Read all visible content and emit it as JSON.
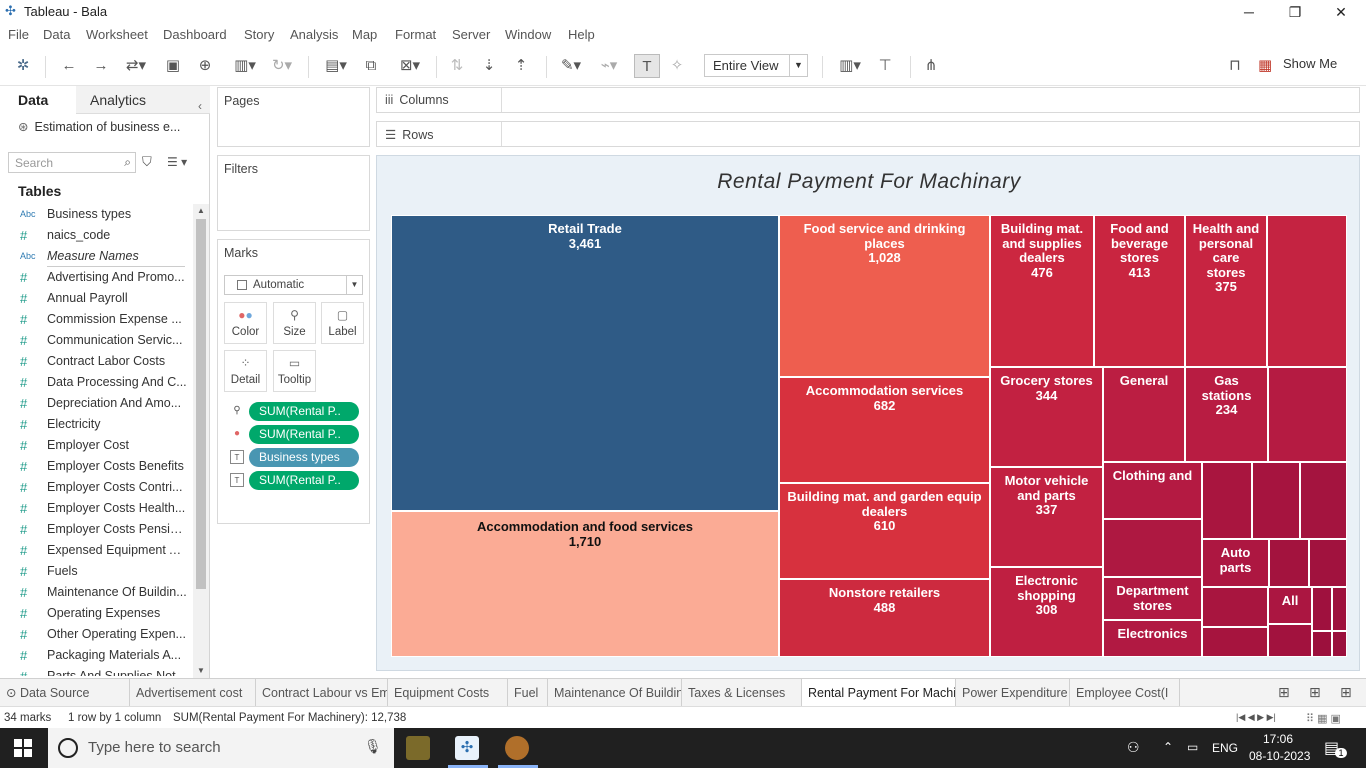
{
  "window": {
    "title": "Tableau - Bala",
    "min": "─",
    "max": "❐",
    "close": "✕"
  },
  "menu": [
    "File",
    "Data",
    "Worksheet",
    "Dashboard",
    "Story",
    "Analysis",
    "Map",
    "Format",
    "Server",
    "Window",
    "Help"
  ],
  "toolbar": {
    "view_select": "Entire View",
    "show_me": "Show Me"
  },
  "datapane": {
    "tab_data": "Data",
    "tab_analytics": "Analytics",
    "datasource": "Estimation of business e...",
    "search_placeholder": "Search",
    "tables_header": "Tables",
    "fields": [
      {
        "type": "Abc",
        "name": "Business types"
      },
      {
        "type": "#",
        "name": "naics_code"
      },
      {
        "type": "Abc",
        "name": "Measure Names"
      },
      {
        "type": "#",
        "name": "Advertising And Promo..."
      },
      {
        "type": "#",
        "name": "Annual Payroll"
      },
      {
        "type": "#",
        "name": "Commission Expense ..."
      },
      {
        "type": "#",
        "name": "Communication Servic..."
      },
      {
        "type": "#",
        "name": "Contract Labor Costs"
      },
      {
        "type": "#",
        "name": "Data Processing And C..."
      },
      {
        "type": "#",
        "name": "Depreciation And Amo..."
      },
      {
        "type": "#",
        "name": "Electricity"
      },
      {
        "type": "#",
        "name": "Employer Cost"
      },
      {
        "type": "#",
        "name": "Employer Costs Benefits"
      },
      {
        "type": "#",
        "name": "Employer Costs Contri..."
      },
      {
        "type": "#",
        "name": "Employer Costs Health..."
      },
      {
        "type": "#",
        "name": "Employer Costs Pensio..."
      },
      {
        "type": "#",
        "name": "Expensed Equipment A..."
      },
      {
        "type": "#",
        "name": "Fuels"
      },
      {
        "type": "#",
        "name": "Maintenance Of Buildin..."
      },
      {
        "type": "#",
        "name": "Operating Expenses"
      },
      {
        "type": "#",
        "name": "Other Operating Expen..."
      },
      {
        "type": "#",
        "name": "Packaging Materials A..."
      },
      {
        "type": "#",
        "name": "Parts And Supplies Not..."
      }
    ]
  },
  "shelves": {
    "pages": "Pages",
    "filters": "Filters",
    "columns": "Columns",
    "rows": "Rows",
    "marks": "Marks",
    "mark_type": "Automatic",
    "mark_buttons": [
      "Color",
      "Size",
      "Label",
      "Detail",
      "Tooltip"
    ],
    "pills": [
      {
        "kind": "size",
        "label": "SUM(Rental P..",
        "color": "#00a86b"
      },
      {
        "kind": "color",
        "label": "SUM(Rental P..",
        "color": "#00a86b"
      },
      {
        "kind": "label",
        "label": "Business types",
        "color": "#4996b2"
      },
      {
        "kind": "label",
        "label": "SUM(Rental P..",
        "color": "#00a86b"
      }
    ]
  },
  "chart_data": {
    "type": "treemap",
    "title": "Rental Payment For Machinary",
    "cells": [
      {
        "name": "Retail Trade",
        "value": "3,461",
        "color": "#2f5b86"
      },
      {
        "name": "Accommodation and food services",
        "value": "1,710",
        "color": "#fbab95"
      },
      {
        "name": "Food service and drinking places",
        "value": "1,028",
        "color": "#ee5e4f"
      },
      {
        "name": "Accommodation services",
        "value": "682",
        "color": "#d7313e"
      },
      {
        "name": "Building mat. and garden equip dealers",
        "value": "610",
        "color": "#d7313e"
      },
      {
        "name": "Nonstore retailers",
        "value": "488",
        "color": "#cd2a3f"
      },
      {
        "name": "Building mat. and supplies dealers",
        "value": "476",
        "color": "#cc2740"
      },
      {
        "name": "Food and beverage stores",
        "value": "413",
        "color": "#c92540"
      },
      {
        "name": "Health and personal care stores",
        "value": "375",
        "color": "#c72441"
      },
      {
        "name": "Grocery stores",
        "value": "344",
        "color": "#c22141"
      },
      {
        "name": "Motor vehicle and parts",
        "value": "337",
        "color": "#c22141"
      },
      {
        "name": "Electronic shopping",
        "value": "308",
        "color": "#bf1f41"
      },
      {
        "name": "General",
        "value": "",
        "color": "#bb1e42"
      },
      {
        "name": "Gas stations",
        "value": "234",
        "color": "#b81c42"
      },
      {
        "name": "Clothing and",
        "value": "",
        "color": "#b41a42"
      },
      {
        "name": "Department stores",
        "value": "",
        "color": "#b11942"
      },
      {
        "name": "Electronics",
        "value": "",
        "color": "#b11942"
      },
      {
        "name": "Auto parts",
        "value": "",
        "color": "#ad1741"
      },
      {
        "name": "All",
        "value": "",
        "color": "#ab1641"
      }
    ],
    "total_label": "SUM(Rental Payment For Machinery): 12,738"
  },
  "sheet_tabs": [
    "Data Source",
    "Advertisement cost",
    "Contract Labour vs Employee",
    "Equipment Costs",
    "Fuel",
    "Maintenance Of Buildings",
    "Taxes & Licenses",
    "Rental Payment For Machinary",
    "Power Expenditure",
    "Employee Cost(I"
  ],
  "active_sheet": "Rental Payment For Machinary",
  "status": {
    "marks": "34 marks",
    "dims": "1 row by 1 column",
    "sum": "SUM(Rental Payment For Machinery): 12,738"
  },
  "taskbar": {
    "search_placeholder": "Type here to search",
    "lang": "ENG",
    "time": "17:06",
    "date": "08-10-2023",
    "notif_count": "1"
  }
}
